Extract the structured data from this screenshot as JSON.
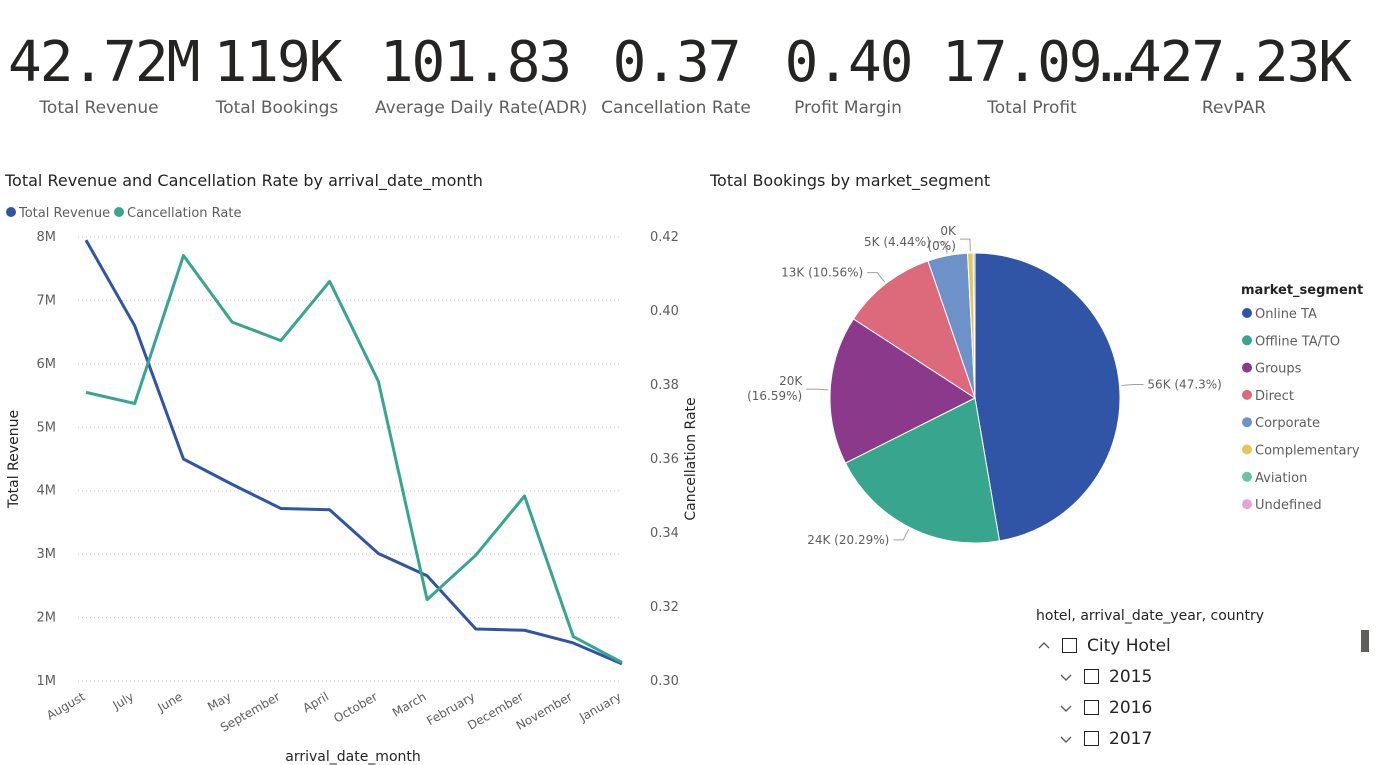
{
  "kpis": [
    {
      "value": "42.72M",
      "label": "Total Revenue"
    },
    {
      "value": "119K",
      "label": "Total Bookings"
    },
    {
      "value": "101.83",
      "label": "Average Daily Rate(ADR)"
    },
    {
      "value": "0.37",
      "label": "Cancellation Rate"
    },
    {
      "value": "0.40",
      "label": "Profit Margin"
    },
    {
      "value": "17.09…",
      "label": "Total Profit"
    },
    {
      "value": "427.23K",
      "label": "RevPAR"
    }
  ],
  "line_chart_title": "Total Revenue and Cancellation Rate by arrival_date_month",
  "pie_chart_title": "Total Bookings by market_segment",
  "colors": {
    "revenue": "#3155a6",
    "cancel": "#38a68f",
    "grid": "#c8c8c8",
    "text": "#605e5c"
  },
  "chart_data": [
    {
      "type": "line",
      "categories": [
        "August",
        "July",
        "June",
        "May",
        "September",
        "April",
        "October",
        "March",
        "February",
        "December",
        "November",
        "January"
      ],
      "series": [
        {
          "name": "Total Revenue",
          "axis": "left",
          "color": "#3155a6",
          "values": [
            7.95,
            6.6,
            4.5,
            4.1,
            3.72,
            3.7,
            3.01,
            2.66,
            1.82,
            1.8,
            1.6,
            1.27
          ]
        },
        {
          "name": "Cancellation Rate",
          "axis": "right",
          "color": "#38a68f",
          "values": [
            0.378,
            0.375,
            0.415,
            0.397,
            0.392,
            0.408,
            0.381,
            0.322,
            0.334,
            0.35,
            0.312,
            0.305
          ]
        }
      ],
      "left_ticks": [
        "8M",
        "7M",
        "6M",
        "5M",
        "4M",
        "3M",
        "2M",
        "1M"
      ],
      "right_ticks": [
        "0.42",
        "0.40",
        "0.38",
        "0.36",
        "0.34",
        "0.32",
        "0.30"
      ],
      "ylim_left_millions": [
        1,
        8
      ],
      "ylim_right": [
        0.3,
        0.42
      ],
      "xlabel": "arrival_date_month",
      "ylabel": "Total Revenue",
      "ylabel_right": "Cancellation Rate",
      "legend_position": "top-left",
      "grid": true
    },
    {
      "type": "pie",
      "legend_title": "market_segment",
      "legend_position": "right",
      "slices": [
        {
          "name": "Online TA",
          "value": 56,
          "label": "56K (47.3%)",
          "percent": 47.3,
          "color": "#3155a6"
        },
        {
          "name": "Offline TA/TO",
          "value": 24,
          "label": "24K (20.29%)",
          "percent": 20.29,
          "color": "#38a68f"
        },
        {
          "name": "Groups",
          "value": 20,
          "label_line1": "20K",
          "label_line2": "(16.59%)",
          "percent": 16.59,
          "color": "#8b3a8b"
        },
        {
          "name": "Direct",
          "value": 13,
          "label": "13K (10.56%)",
          "percent": 10.56,
          "color": "#dc6a7a"
        },
        {
          "name": "Corporate",
          "value": 5,
          "label": "5K (4.44%)",
          "percent": 4.44,
          "color": "#6d92c9"
        },
        {
          "name": "Complementary",
          "value": 1,
          "label_line1": "0K",
          "label_line2": "(0%)",
          "percent": 0.62,
          "color": "#e8c55a"
        },
        {
          "name": "Aviation",
          "value": 0,
          "percent": 0.2,
          "color": "#6cc4a6"
        },
        {
          "name": "Undefined",
          "value": 0,
          "percent": 0,
          "color": "#e8a3d6"
        }
      ]
    }
  ],
  "slicer": {
    "title": "hotel, arrival_date_year, country",
    "items": [
      {
        "label": "City Hotel",
        "level": 0,
        "expanded": true
      },
      {
        "label": "2015",
        "level": 1,
        "expanded": false
      },
      {
        "label": "2016",
        "level": 1,
        "expanded": false
      },
      {
        "label": "2017",
        "level": 1,
        "expanded": false
      }
    ]
  }
}
